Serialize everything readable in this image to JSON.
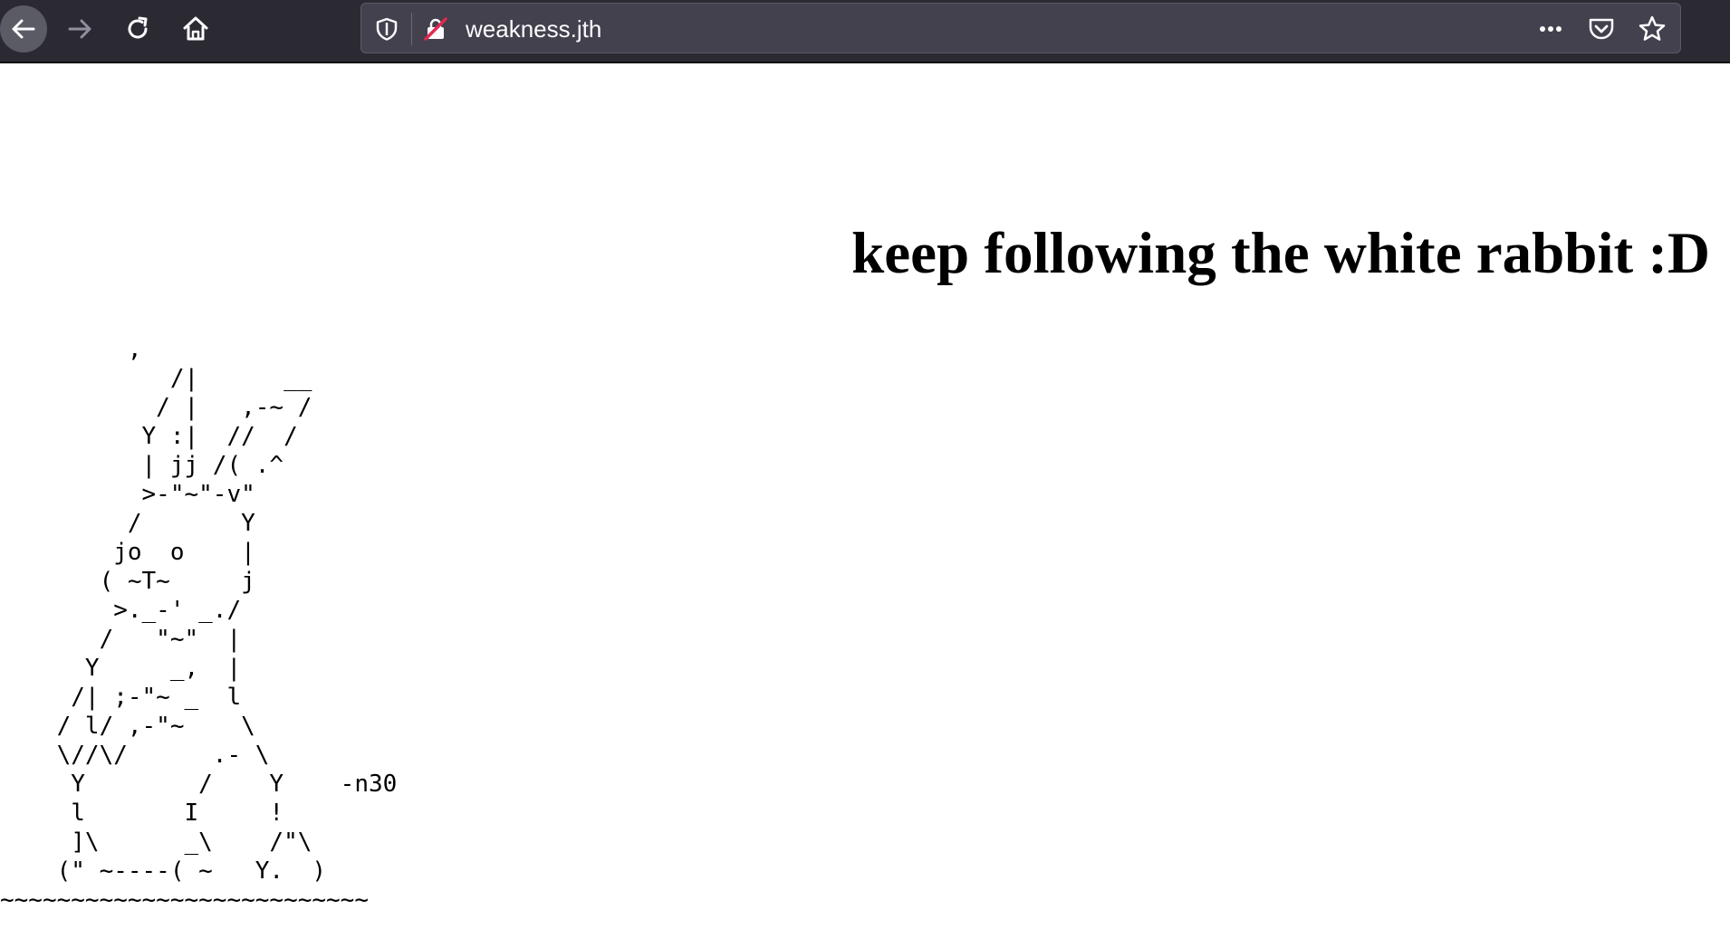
{
  "browser": {
    "url": "weakness.jth",
    "icons": {
      "back": "arrow-left-icon",
      "forward": "arrow-right-icon",
      "reload": "reload-icon",
      "home": "home-icon",
      "tracking": "shield-icon",
      "insecure": "insecure-lock-icon",
      "menu": "more-dots-icon",
      "pocket": "pocket-icon",
      "bookmark": "star-icon"
    },
    "colors": {
      "toolbar": "#2b2a33",
      "urlbar": "#42414d",
      "icon": "#fbfbfe",
      "insecure_slash": "#e22850"
    }
  },
  "page": {
    "heading": "keep following the white rabbit :D",
    "ascii_art": "         ,\n            /|      __\n           / |   ,-~ /\n          Y :|  //  /\n          | jj /( .^\n          >-\"~\"-v\"\n         /       Y\n        jo  o    |\n       ( ~T~     j\n        >._-' _./\n       /   \"~\"  |\n      Y     _,  |\n     /| ;-\"~ _  l\n    / l/ ,-\"~    \\\n    \\//\\/      .- \\\n     Y        /    Y    -n30\n     l       I     !\n     ]\\      _\\    /\"\\\n    (\" ~----( ~   Y.  )\n~~~~~~~~~~~~~~~~~~~~~~~~~~"
  }
}
